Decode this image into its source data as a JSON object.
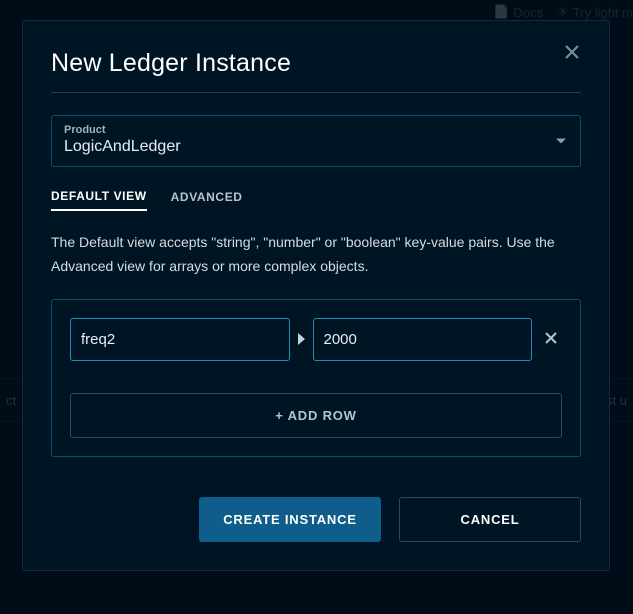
{
  "bg": {
    "docs_label": "Docs",
    "light_label": "Try light m",
    "strip_left": "ct",
    "strip_right": "st u"
  },
  "modal": {
    "title": "New Ledger Instance",
    "product": {
      "label": "Product",
      "value": "LogicAndLedger"
    },
    "tabs": {
      "default": "DEFAULT VIEW",
      "advanced": "ADVANCED"
    },
    "help_text": "The Default view accepts \"string\", \"number\" or \"boolean\" key-value pairs. Use the Advanced view for arrays or more complex objects.",
    "row": {
      "key": "freq2",
      "value": "2000"
    },
    "add_row_label": "+ ADD ROW",
    "buttons": {
      "create": "CREATE INSTANCE",
      "cancel": "CANCEL"
    }
  }
}
